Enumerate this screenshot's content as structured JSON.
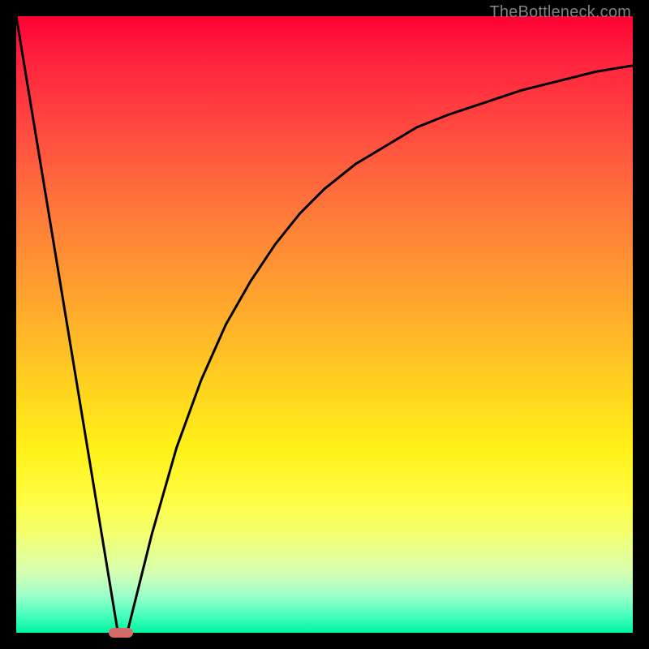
{
  "watermark": "TheBottleneck.com",
  "colors": {
    "frame": "#000000",
    "curve": "#000000",
    "marker": "#d46a6a",
    "watermark": "#808080",
    "gradient_top": "#ff0033",
    "gradient_bottom": "#00f4a0"
  },
  "chart_data": {
    "type": "line",
    "title": "",
    "xlabel": "",
    "ylabel": "",
    "xlim": [
      0,
      100
    ],
    "ylim": [
      0,
      100
    ],
    "grid": false,
    "legend": false,
    "series": [
      {
        "name": "left-falling-line",
        "x": [
          0,
          16.5
        ],
        "values": [
          100,
          0
        ]
      },
      {
        "name": "right-rising-curve",
        "x": [
          18,
          22,
          26,
          30,
          34,
          38,
          42,
          46,
          50,
          55,
          60,
          65,
          70,
          76,
          82,
          88,
          94,
          100
        ],
        "values": [
          0,
          16,
          30,
          41,
          50,
          57,
          63,
          68,
          72,
          76,
          79,
          82,
          84,
          86,
          88,
          89.5,
          91,
          92
        ]
      }
    ],
    "marker": {
      "name": "bottom-optimum-marker",
      "x_center_pct": 17,
      "width_pct": 4,
      "y_pct": 0,
      "color": "#d46a6a"
    },
    "background_gradient": {
      "direction": "vertical",
      "stops": [
        {
          "pct": 0,
          "color": "#ff0033"
        },
        {
          "pct": 18,
          "color": "#ff4840"
        },
        {
          "pct": 46,
          "color": "#ffa52e"
        },
        {
          "pct": 70,
          "color": "#fff018"
        },
        {
          "pct": 90,
          "color": "#d8ffb0"
        },
        {
          "pct": 100,
          "color": "#00f4a0"
        }
      ]
    }
  }
}
